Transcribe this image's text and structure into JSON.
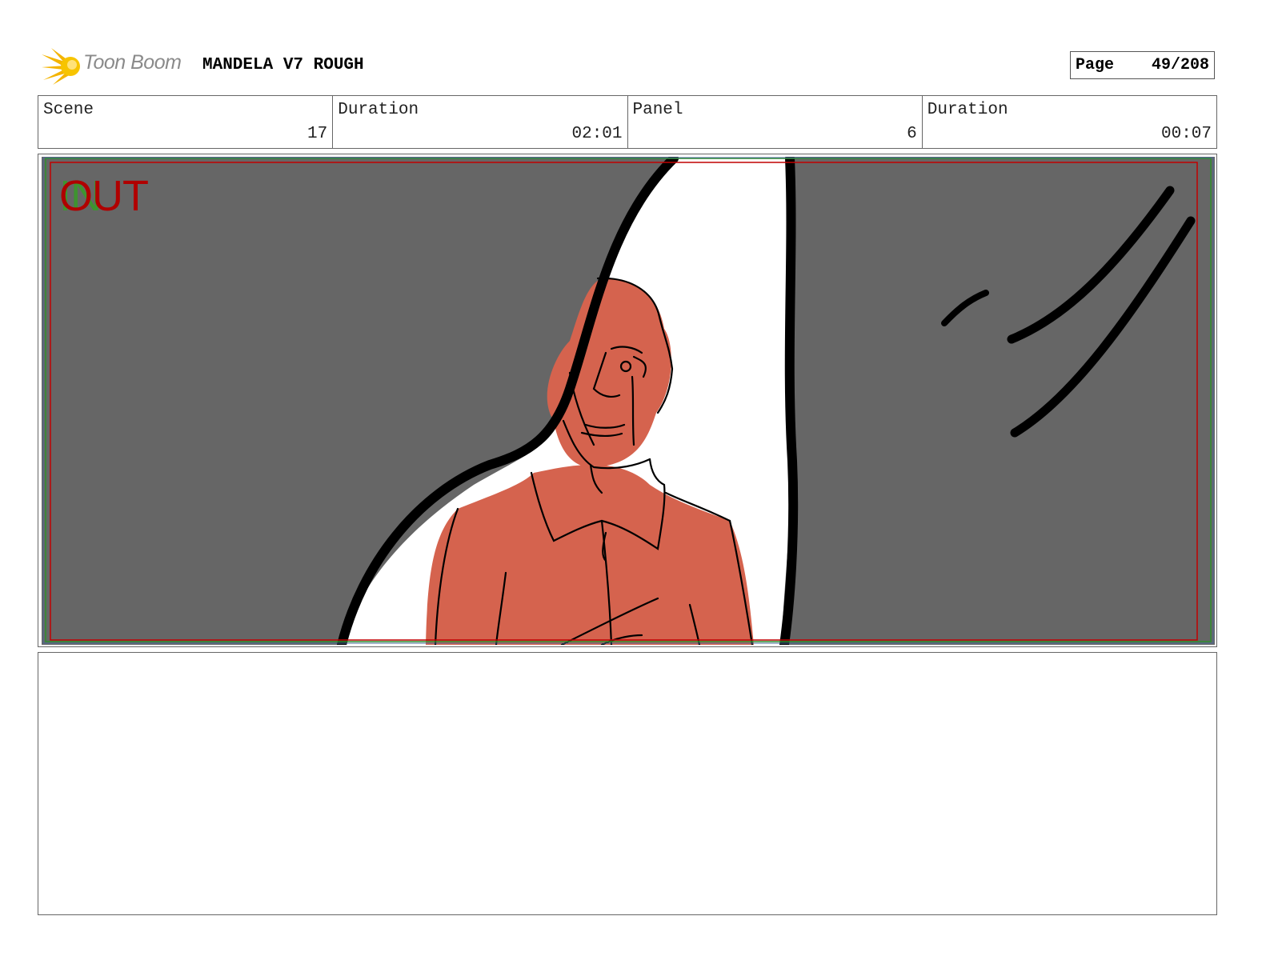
{
  "header": {
    "logo_text": "Toon Boom",
    "project_title": "MANDELA V7 ROUGH",
    "page_label": "Page",
    "page_number": "49/208"
  },
  "info": {
    "scene_label": "Scene",
    "scene_value": "17",
    "scene_duration_label": "Duration",
    "scene_duration_value": "02:01",
    "panel_label": "Panel",
    "panel_value": "6",
    "panel_duration_label": "Duration",
    "panel_duration_value": "00:07"
  },
  "panel": {
    "transition_in_ghost": "IN",
    "transition_label": "OUT",
    "colors": {
      "background": "#666666",
      "figure": "#d5634e",
      "ink": "#000000",
      "safe_frame_red": "#c00000",
      "safe_frame_green": "#2f8f2f"
    }
  },
  "notes": {}
}
